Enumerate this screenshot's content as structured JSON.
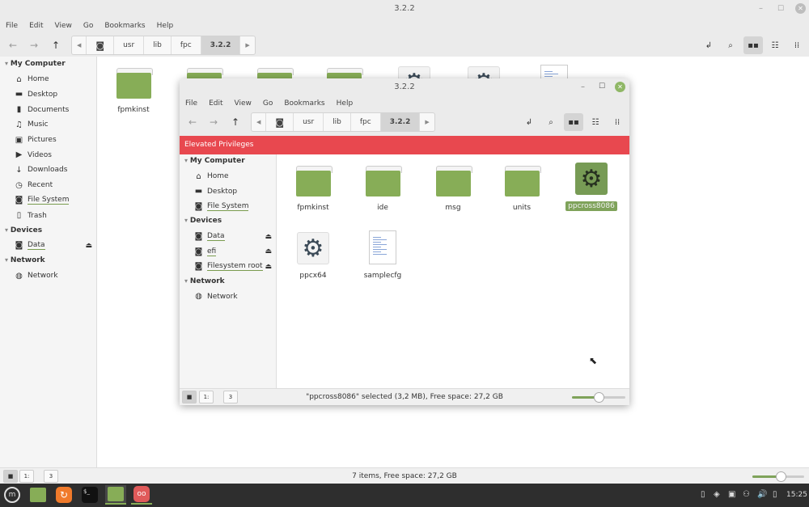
{
  "background_window": {
    "title": "3.2.2",
    "menu": [
      "File",
      "Edit",
      "View",
      "Go",
      "Bookmarks",
      "Help"
    ],
    "breadcrumbs": [
      "usr",
      "lib",
      "fpc",
      "3.2.2"
    ],
    "sidebar": {
      "sections": [
        {
          "title": "My Computer",
          "items": [
            {
              "label": "Home",
              "icon": "home-icon"
            },
            {
              "label": "Desktop",
              "icon": "desktop-icon"
            },
            {
              "label": "Documents",
              "icon": "documents-icon"
            },
            {
              "label": "Music",
              "icon": "music-icon"
            },
            {
              "label": "Pictures",
              "icon": "pictures-icon"
            },
            {
              "label": "Videos",
              "icon": "videos-icon"
            },
            {
              "label": "Downloads",
              "icon": "downloads-icon"
            },
            {
              "label": "Recent",
              "icon": "recent-icon"
            },
            {
              "label": "File System",
              "icon": "drive-icon"
            },
            {
              "label": "Trash",
              "icon": "trash-icon"
            }
          ]
        },
        {
          "title": "Devices",
          "items": [
            {
              "label": "Data",
              "icon": "drive-icon",
              "eject": true
            }
          ]
        },
        {
          "title": "Network",
          "items": [
            {
              "label": "Network",
              "icon": "network-icon"
            }
          ]
        }
      ]
    },
    "files": [
      {
        "name": "fpmkinst",
        "type": "folder"
      },
      {
        "name": "",
        "type": "folder"
      },
      {
        "name": "",
        "type": "folder"
      },
      {
        "name": "",
        "type": "folder"
      },
      {
        "name": "",
        "type": "executable"
      },
      {
        "name": "",
        "type": "executable"
      },
      {
        "name": "",
        "type": "text"
      }
    ],
    "status": "7 items, Free space: 27,2 GB",
    "zoom_level": 0.55
  },
  "dialog_window": {
    "title": "3.2.2",
    "menu": [
      "File",
      "Edit",
      "View",
      "Go",
      "Bookmarks",
      "Help"
    ],
    "breadcrumbs": [
      "usr",
      "lib",
      "fpc",
      "3.2.2"
    ],
    "banner": "Elevated Privileges",
    "banner_color": "#e8484f",
    "sidebar": {
      "sections": [
        {
          "title": "My Computer",
          "items": [
            {
              "label": "Home",
              "icon": "home-icon"
            },
            {
              "label": "Desktop",
              "icon": "desktop-icon"
            },
            {
              "label": "File System",
              "icon": "drive-icon"
            }
          ]
        },
        {
          "title": "Devices",
          "items": [
            {
              "label": "Data",
              "icon": "drive-icon",
              "eject": true
            },
            {
              "label": "efi",
              "icon": "drive-icon",
              "eject": true
            },
            {
              "label": "Filesystem root",
              "icon": "drive-icon",
              "eject": true
            }
          ]
        },
        {
          "title": "Network",
          "items": [
            {
              "label": "Network",
              "icon": "network-icon"
            }
          ]
        }
      ]
    },
    "files": [
      {
        "name": "fpmkinst",
        "type": "folder"
      },
      {
        "name": "ide",
        "type": "folder"
      },
      {
        "name": "msg",
        "type": "folder"
      },
      {
        "name": "units",
        "type": "folder"
      },
      {
        "name": "ppcross8086",
        "type": "executable",
        "selected": true
      },
      {
        "name": "ppcx64",
        "type": "executable"
      },
      {
        "name": "samplecfg",
        "type": "text"
      }
    ],
    "status": "\"ppcross8086\" selected (3,2 MB), Free space: 27,2 GB",
    "zoom_level": 0.5
  },
  "taskbar": {
    "clock": "15:25",
    "accent": "#87ad57"
  }
}
